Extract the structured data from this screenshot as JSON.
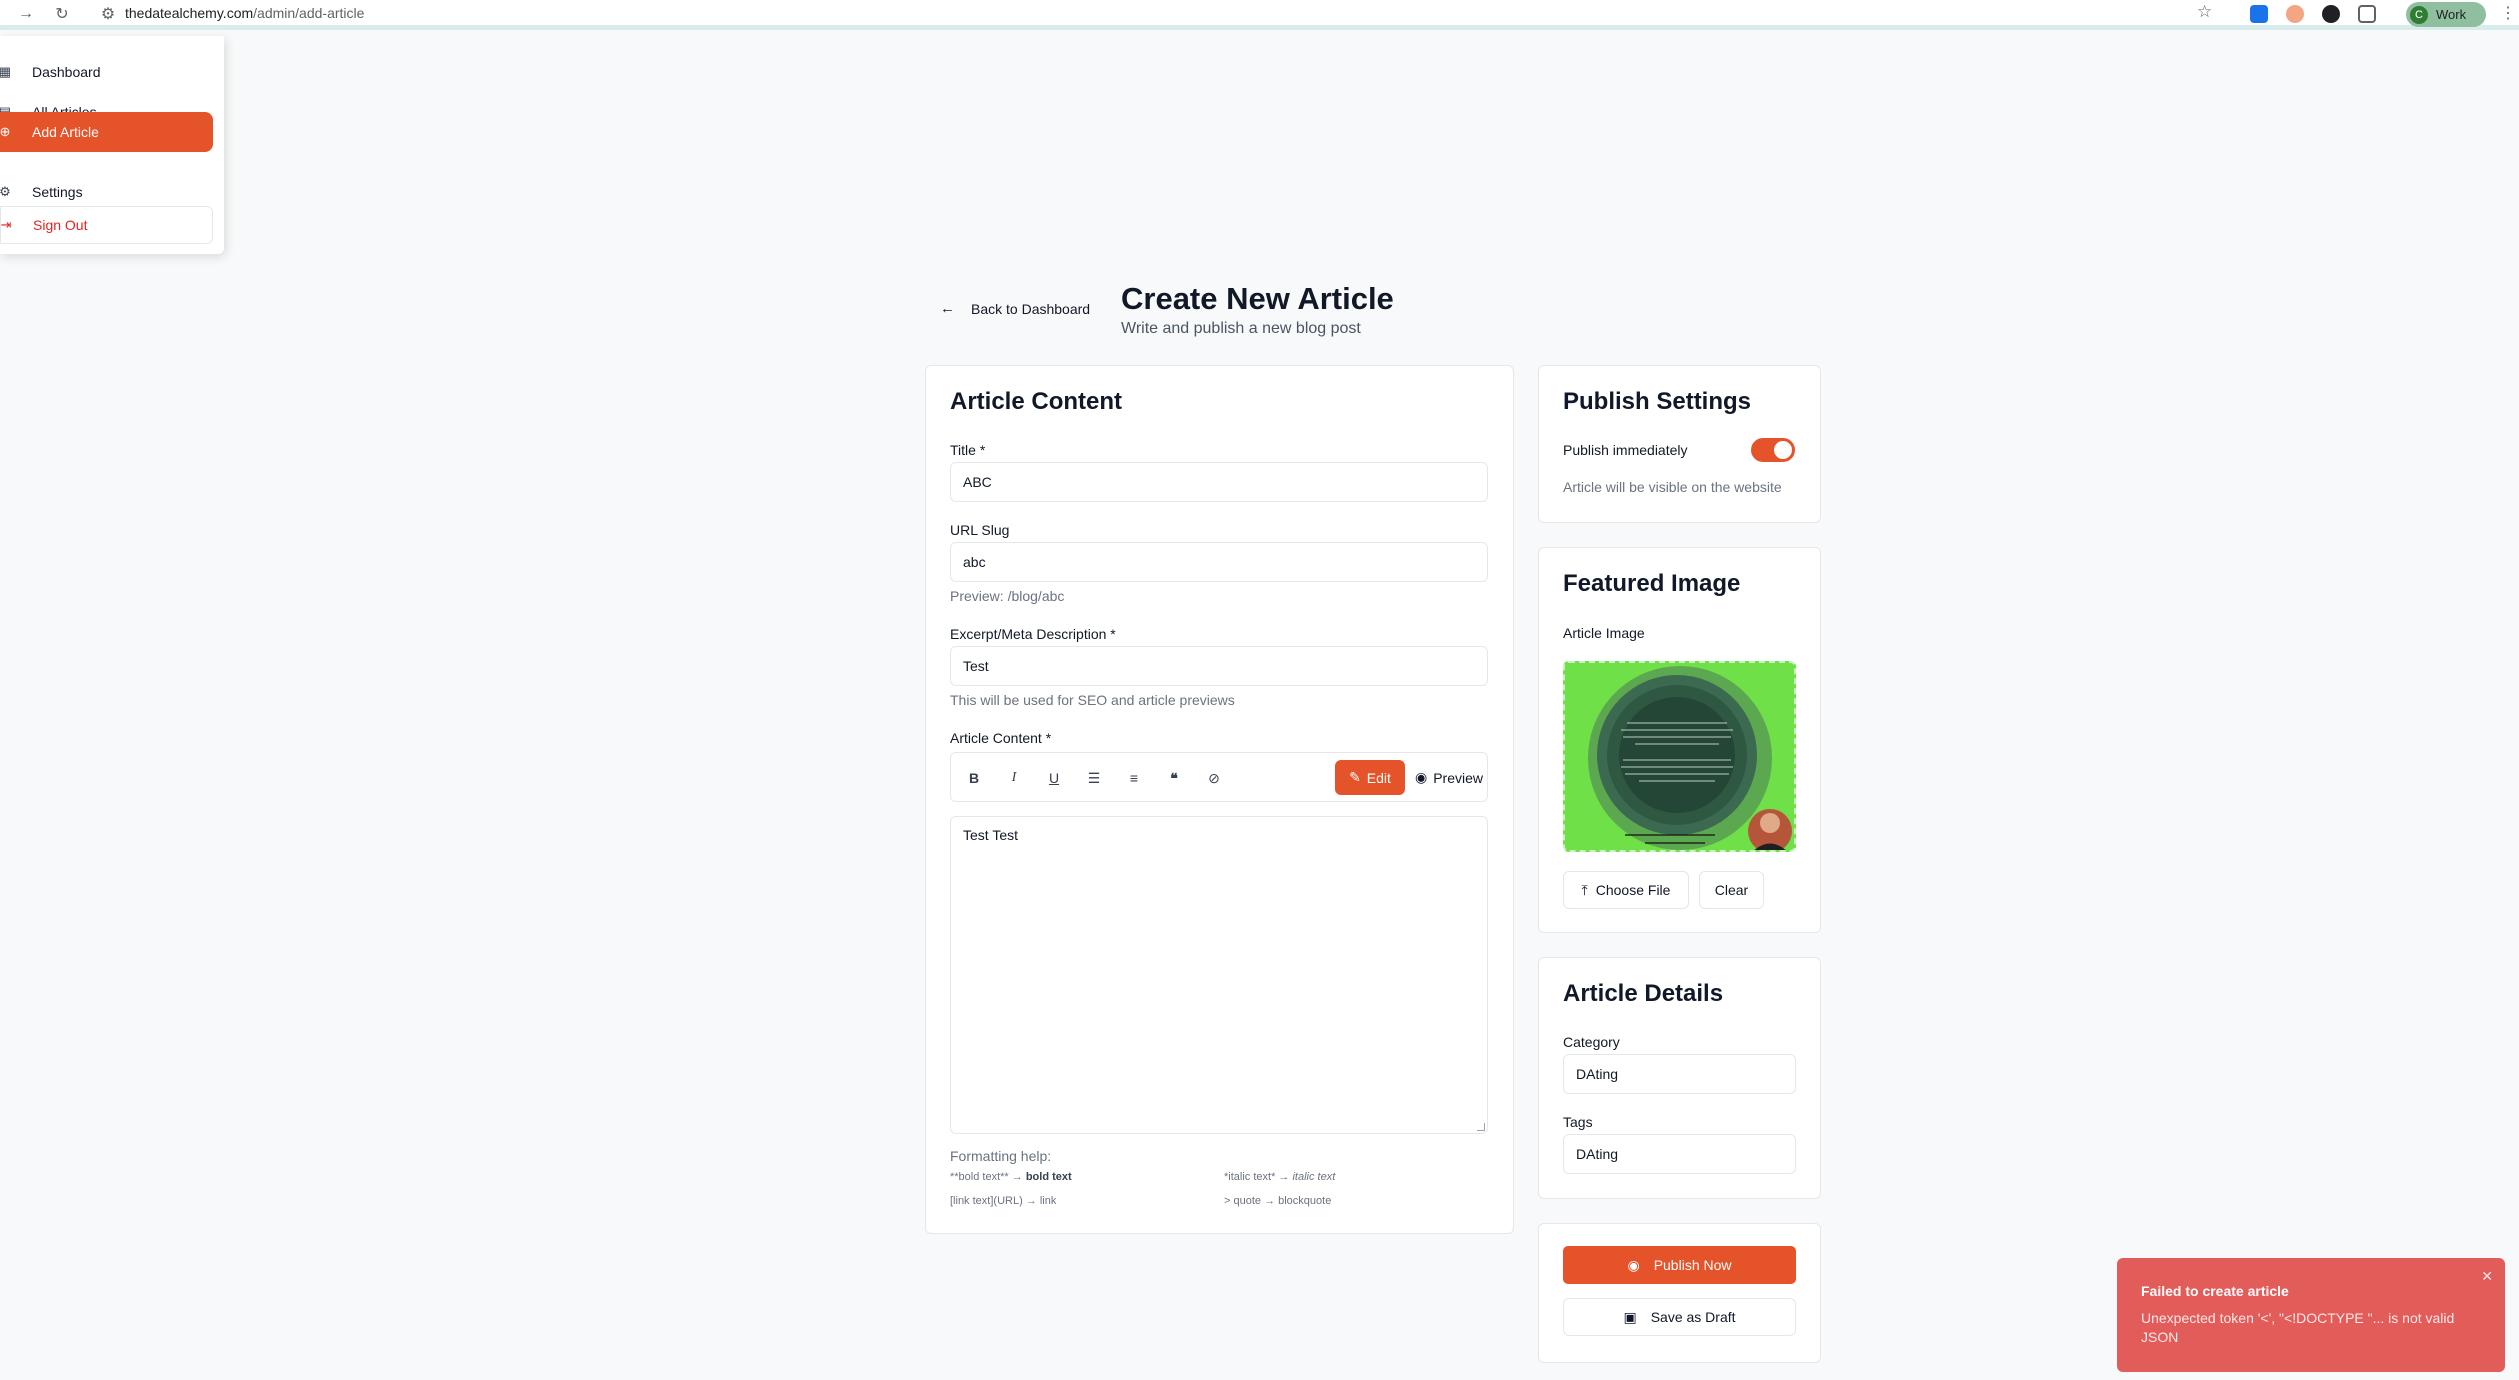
{
  "browser": {
    "url_domain": "thedatealchemy.com",
    "url_path": "/admin/add-article",
    "profile_label": "Work",
    "profile_initial": "C"
  },
  "sidebar": {
    "items": [
      {
        "label": "Dashboard",
        "icon": "dashboard-icon"
      },
      {
        "label": "All Articles",
        "icon": "file-text-icon"
      },
      {
        "label": "Add Article",
        "icon": "plus-circle-icon"
      },
      {
        "label": "Settings",
        "icon": "gear-icon"
      }
    ],
    "sign_out": "Sign Out"
  },
  "header": {
    "back_label": "Back to Dashboard",
    "title": "Create New Article",
    "subtitle": "Write and publish a new blog post"
  },
  "article": {
    "card_title": "Article Content",
    "title_label": "Title *",
    "title_value": "ABC",
    "slug_label": "URL Slug",
    "slug_value": "abc",
    "slug_preview": "Preview: /blog/abc",
    "excerpt_label": "Excerpt/Meta Description *",
    "excerpt_value": "Test",
    "excerpt_hint": "This will be used for SEO and article previews",
    "content_label": "Article Content *",
    "edit_label": "Edit",
    "preview_label": "Preview",
    "content_value": "Test Test",
    "formatting_help": "Formatting help:",
    "help_bold_src": "**bold text** →",
    "help_bold_out": "bold text",
    "help_italic_src": "*italic text* →",
    "help_italic_out": "italic text",
    "help_link": "[link text](URL) → link",
    "help_quote": "> quote → blockquote"
  },
  "publish": {
    "card_title": "Publish Settings",
    "toggle_label": "Publish immediately",
    "toggle_on": true,
    "hint": "Article will be visible on the website"
  },
  "featured": {
    "card_title": "Featured Image",
    "image_label": "Article Image",
    "choose_file": "Choose File",
    "clear": "Clear"
  },
  "details": {
    "card_title": "Article Details",
    "category_label": "Category",
    "category_value": "DAting",
    "tags_label": "Tags",
    "tags_value": "DAting"
  },
  "actions": {
    "publish_now": "Publish Now",
    "save_draft": "Save as Draft"
  },
  "toast": {
    "title": "Failed to create article",
    "message": "Unexpected token '<', \"<!DOCTYPE \"... is not valid JSON"
  },
  "colors": {
    "accent": "#e4532a",
    "toast": "#e25c5a",
    "image_bg": "#6fe048"
  }
}
